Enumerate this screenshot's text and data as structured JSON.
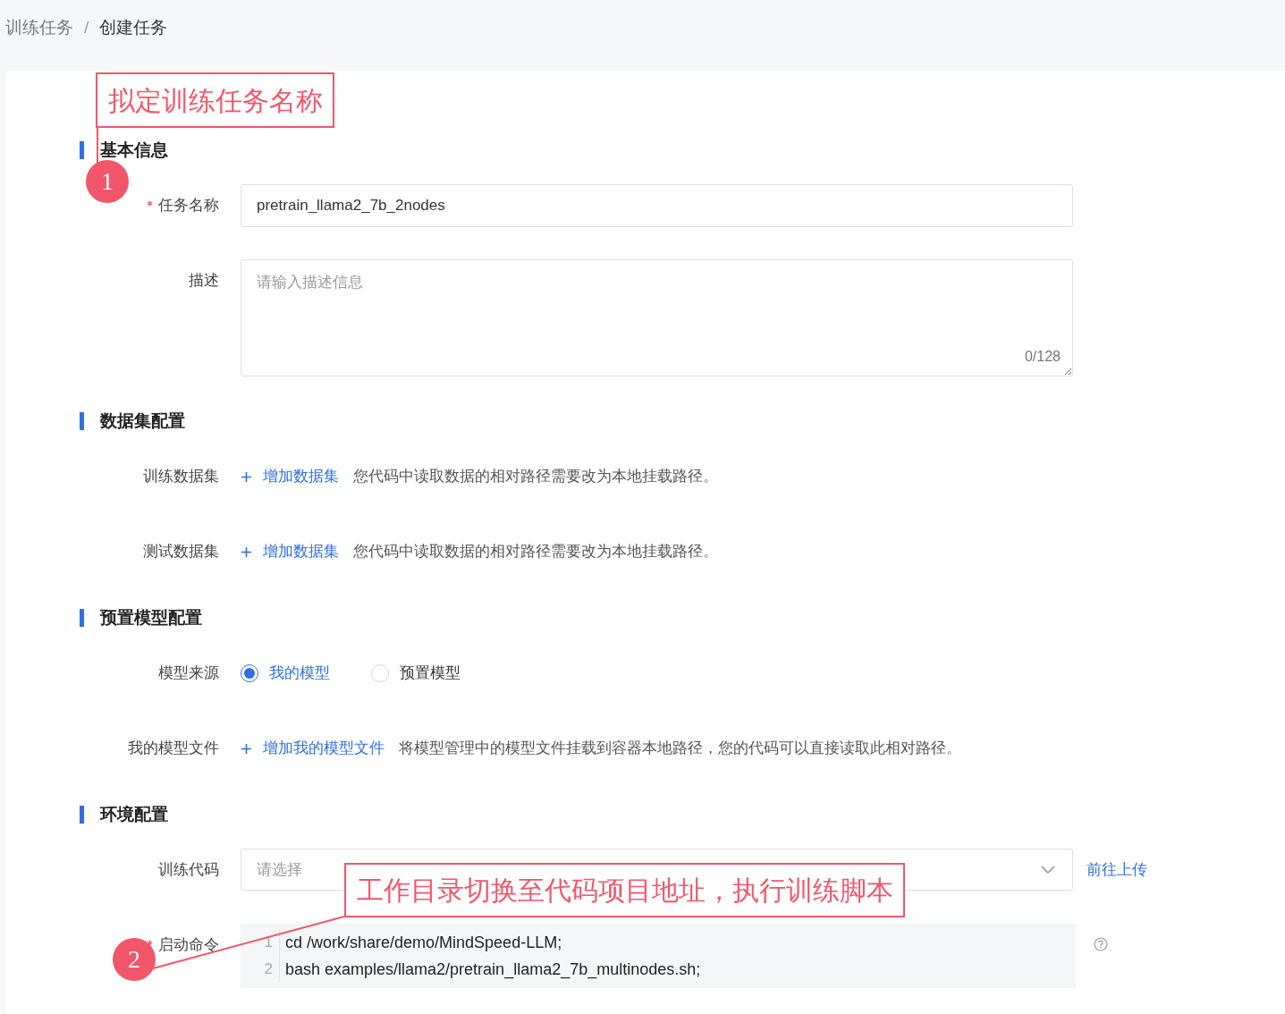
{
  "breadcrumb": {
    "items": [
      "训练任务",
      "创建任务"
    ],
    "separator": "/"
  },
  "sections": [
    {
      "title": "基本信息",
      "fields": [
        {
          "kind": "input",
          "label": "任务名称",
          "required": true,
          "value": "pretrain_llama2_7b_2nodes"
        },
        {
          "kind": "textarea",
          "label": "描述",
          "required": false,
          "placeholder": "请输入描述信息",
          "counter": "0/128"
        }
      ]
    },
    {
      "title": "数据集配置",
      "fields": [
        {
          "kind": "action",
          "label": "训练数据集",
          "required": false,
          "action": "增加数据集",
          "hint": "您代码中读取数据的相对路径需要改为本地挂载路径。"
        },
        {
          "kind": "action",
          "label": "测试数据集",
          "required": false,
          "action": "增加数据集",
          "hint": "您代码中读取数据的相对路径需要改为本地挂载路径。"
        }
      ]
    },
    {
      "title": "预置模型配置",
      "fields": [
        {
          "kind": "radio",
          "label": "模型来源",
          "required": false,
          "options": [
            {
              "label": "我的模型",
              "selected": true
            },
            {
              "label": "预置模型",
              "selected": false
            }
          ]
        },
        {
          "kind": "action",
          "label": "我的模型文件",
          "required": false,
          "action": "增加我的模型文件",
          "hint": "将模型管理中的模型文件挂载到容器本地路径，您的代码可以直接读取此相对路径。"
        }
      ]
    },
    {
      "title": "环境配置",
      "fields": [
        {
          "kind": "select",
          "label": "训练代码",
          "required": false,
          "placeholder": "请选择",
          "link": "前往上传"
        },
        {
          "kind": "code",
          "label": "启动命令",
          "required": true,
          "lines": [
            {
              "number": "1",
              "text": "cd /work/share/demo/MindSpeed-LLM;"
            },
            {
              "number": "2",
              "text": "bash examples/llama2/pretrain_llama2_7b_multinodes.sh;"
            }
          ]
        }
      ]
    }
  ],
  "annotations": [
    {
      "text": "拟定训练任务名称",
      "number": "1"
    },
    {
      "text": "工作目录切换至代码项目地址，执行训练脚本",
      "number": "2"
    }
  ]
}
